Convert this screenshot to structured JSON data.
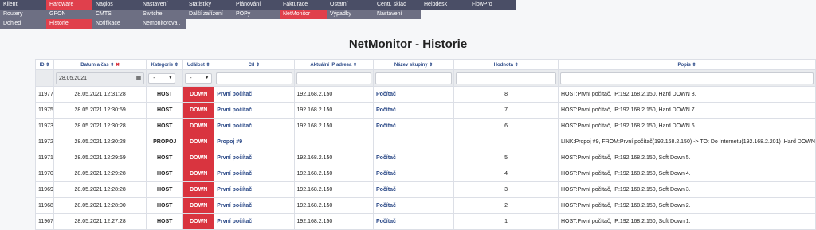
{
  "menu": {
    "row1": [
      "Klienti",
      "Hardware",
      "Nagios",
      "Nastavení",
      "Statistiky",
      "Plánování",
      "Fakturace",
      "Ostatní",
      "Centr. sklad",
      "Helpdesk",
      "FlowPro"
    ],
    "row2": [
      "Routery",
      "GPON",
      "CMTS",
      "Switche",
      "Další zařízení",
      "POPy",
      "NetMonitor",
      "Výpadky",
      "Nastavení"
    ],
    "row3": [
      "Dohled",
      "Historie",
      "Notifikace",
      "Nemonitorova.."
    ]
  },
  "page": {
    "title": "NetMonitor - Historie"
  },
  "table": {
    "headers": {
      "id": "ID ⇕",
      "datetime": "Datum a čas ⇕",
      "category": "Kategorie ⇕",
      "event": "Událost ⇕",
      "target": "Cíl ⇕",
      "ip": "Aktuální IP adresa ⇕",
      "group": "Název skupiny ⇕",
      "value": "Hodnota ⇕",
      "desc": "Popis ⇕"
    },
    "clear_icon": "✖",
    "filter": {
      "date": "28.05.2021",
      "category": "-",
      "event": "-"
    },
    "rows": [
      {
        "id": "11977",
        "dt": "28.05.2021 12:31:28",
        "cat": "HOST",
        "ev": "DOWN",
        "target": "První počítač",
        "ip": "192.168.2.150",
        "group": "Počítač",
        "val": "8",
        "desc": "HOST:První počítač, IP:192.168.2.150, Hard DOWN 8."
      },
      {
        "id": "11975",
        "dt": "28.05.2021 12:30:59",
        "cat": "HOST",
        "ev": "DOWN",
        "target": "První počítač",
        "ip": "192.168.2.150",
        "group": "Počítač",
        "val": "7",
        "desc": "HOST:První počítač, IP:192.168.2.150, Hard DOWN 7."
      },
      {
        "id": "11973",
        "dt": "28.05.2021 12:30:28",
        "cat": "HOST",
        "ev": "DOWN",
        "target": "První počítač",
        "ip": "192.168.2.150",
        "group": "Počítač",
        "val": "6",
        "desc": "HOST:První počítač, IP:192.168.2.150, Hard DOWN 6."
      },
      {
        "id": "11972",
        "dt": "28.05.2021 12:30:28",
        "cat": "PROPOJ",
        "ev": "DOWN",
        "target": "Propoj #9",
        "ip": "",
        "group": "",
        "val": "",
        "desc": "LINK:Propoj #9, FROM:První počítač(192.168.2.150) -> TO: Do Internetu(192.168.2.201) ,Hard DOWN"
      },
      {
        "id": "11971",
        "dt": "28.05.2021 12:29:59",
        "cat": "HOST",
        "ev": "DOWN",
        "target": "První počítač",
        "ip": "192.168.2.150",
        "group": "Počítač",
        "val": "5",
        "desc": "HOST:První počítač, IP:192.168.2.150, Soft Down 5."
      },
      {
        "id": "11970",
        "dt": "28.05.2021 12:29:28",
        "cat": "HOST",
        "ev": "DOWN",
        "target": "První počítač",
        "ip": "192.168.2.150",
        "group": "Počítač",
        "val": "4",
        "desc": "HOST:První počítač, IP:192.168.2.150, Soft Down 4."
      },
      {
        "id": "11969",
        "dt": "28.05.2021 12:28:28",
        "cat": "HOST",
        "ev": "DOWN",
        "target": "První počítač",
        "ip": "192.168.2.150",
        "group": "Počítač",
        "val": "3",
        "desc": "HOST:První počítač, IP:192.168.2.150, Soft Down 3."
      },
      {
        "id": "11968",
        "dt": "28.05.2021 12:28:00",
        "cat": "HOST",
        "ev": "DOWN",
        "target": "První počítač",
        "ip": "192.168.2.150",
        "group": "Počítač",
        "val": "2",
        "desc": "HOST:První počítač, IP:192.168.2.150, Soft Down 2."
      },
      {
        "id": "11967",
        "dt": "28.05.2021 12:27:28",
        "cat": "HOST",
        "ev": "DOWN",
        "target": "První počítač",
        "ip": "192.168.2.150",
        "group": "Počítač",
        "val": "1",
        "desc": "HOST:První počítač, IP:192.168.2.150, Soft Down 1."
      }
    ]
  }
}
